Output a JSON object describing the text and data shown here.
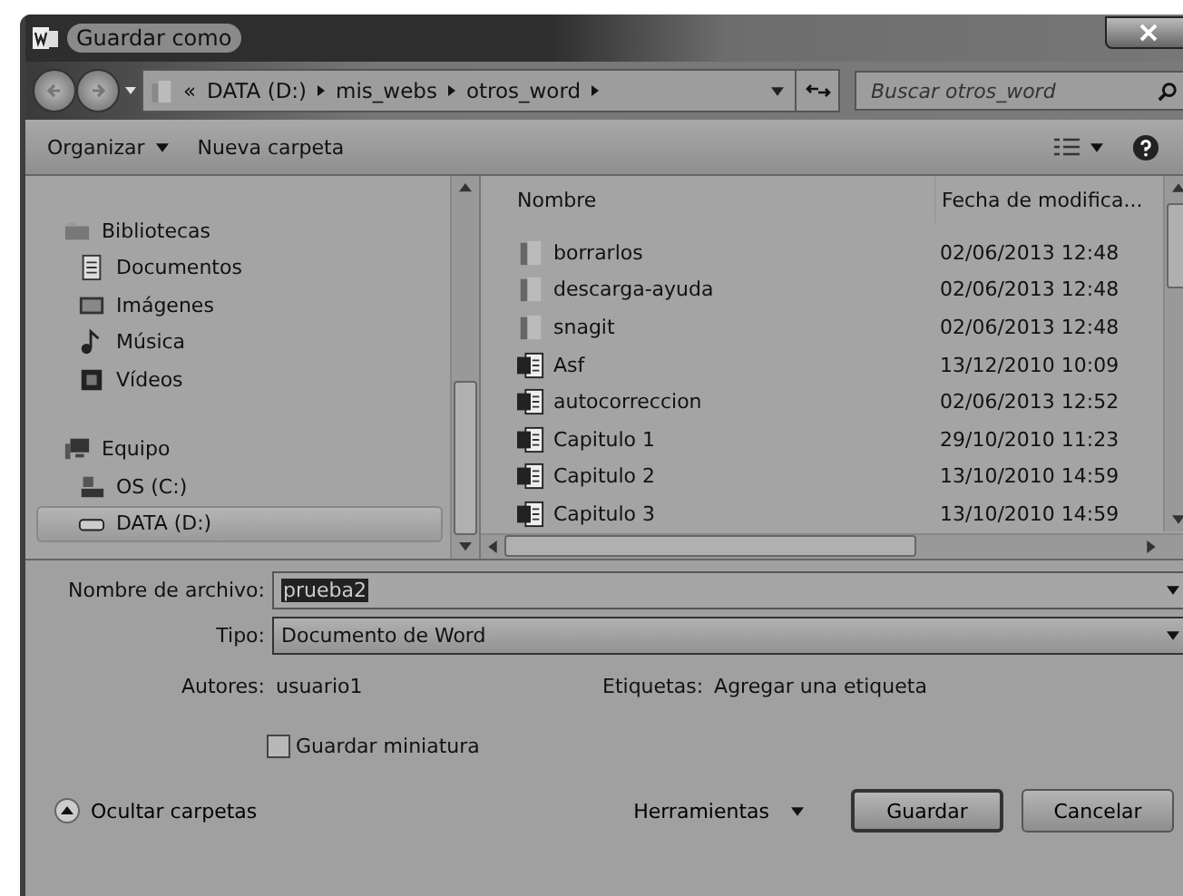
{
  "window": {
    "title": "Guardar como"
  },
  "address": {
    "overflow": "«",
    "segments": [
      "DATA (D:)",
      "mis_webs",
      "otros_word"
    ]
  },
  "search": {
    "placeholder": "Buscar otros_word"
  },
  "toolbar": [
    {
      "label": "Organizar",
      "dropdown": true
    },
    {
      "label": "Nueva carpeta",
      "dropdown": false
    }
  ],
  "nav": [
    {
      "label": "Bibliotecas",
      "kind": "library",
      "selected": false,
      "children": [
        {
          "label": "Documentos",
          "kind": "documents",
          "selected": false
        },
        {
          "label": "Imágenes",
          "kind": "images",
          "selected": false
        },
        {
          "label": "Música",
          "kind": "music",
          "selected": false
        },
        {
          "label": "Vídeos",
          "kind": "videos",
          "selected": false
        }
      ]
    },
    {
      "label": "Equipo",
      "kind": "computer",
      "selected": false,
      "children": [
        {
          "label": "OS (C:)",
          "kind": "system-drive",
          "selected": false
        },
        {
          "label": "DATA (D:)",
          "kind": "drive",
          "selected": true
        }
      ]
    }
  ],
  "files": {
    "columns": [
      "Nombre",
      "Fecha de modifica..."
    ],
    "rows": [
      {
        "name": "borrarlos",
        "date": "02/06/2013 12:48",
        "kind": "folder"
      },
      {
        "name": "descarga-ayuda",
        "date": "02/06/2013 12:48",
        "kind": "folder"
      },
      {
        "name": "snagit",
        "date": "02/06/2013 12:48",
        "kind": "folder"
      },
      {
        "name": "Asf",
        "date": "13/12/2010 10:09",
        "kind": "document"
      },
      {
        "name": "autocorreccion",
        "date": "02/06/2013 12:52",
        "kind": "document"
      },
      {
        "name": "Capitulo 1",
        "date": "29/10/2010 11:23",
        "kind": "document"
      },
      {
        "name": "Capitulo 2",
        "date": "13/10/2010 14:59",
        "kind": "document"
      },
      {
        "name": "Capitulo 3",
        "date": "13/10/2010 14:59",
        "kind": "document"
      }
    ]
  },
  "form": {
    "filename": {
      "label": "Nombre de archivo:",
      "value": "prueba2",
      "text_selected": true
    },
    "type": {
      "label": "Tipo:",
      "value": "Documento de Word"
    },
    "authors": {
      "label": "Autores:",
      "value": "usuario1"
    },
    "tags": {
      "label": "Etiquetas:",
      "value": "Agregar una etiqueta"
    },
    "thumbnail": {
      "label": "Guardar miniatura",
      "checked": false
    }
  },
  "footer": {
    "hide_folders": "Ocultar carpetas",
    "tools": "Herramientas",
    "buttons": [
      {
        "label": "Guardar",
        "default": true
      },
      {
        "label": "Cancelar",
        "default": false
      }
    ]
  }
}
